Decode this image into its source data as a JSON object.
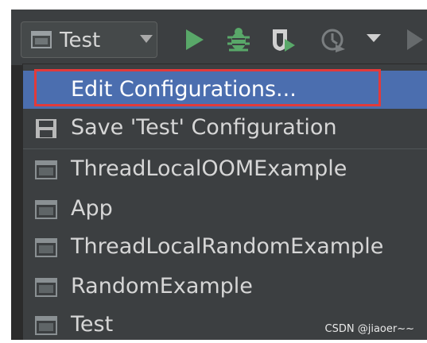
{
  "toolbar": {
    "run_config": {
      "label": "Test",
      "icon": "run-config-icon",
      "caret": "chevron-down-icon"
    },
    "buttons": [
      {
        "name": "run-button",
        "icon": "play-icon",
        "color": "#59a869"
      },
      {
        "name": "debug-button",
        "icon": "bug-icon",
        "color": "#59a869"
      },
      {
        "name": "coverage-button",
        "icon": "shield-play-icon",
        "color": "#59a869"
      },
      {
        "name": "profiler-button",
        "icon": "clock-icon",
        "color": "#8c8c8c"
      },
      {
        "name": "more-button",
        "icon": "chevron-down-icon",
        "color": "#8c8c8c"
      }
    ]
  },
  "menu": {
    "items": [
      {
        "label": "Edit Configurations...",
        "icon": "",
        "selected": true
      },
      {
        "label": "Save 'Test' Configuration",
        "icon": "save-icon",
        "selected": false
      },
      {
        "label": "ThreadLocalOOMExample",
        "icon": "run-config-icon",
        "selected": false
      },
      {
        "label": "App",
        "icon": "run-config-icon",
        "selected": false
      },
      {
        "label": "ThreadLocalRandomExample",
        "icon": "run-config-icon",
        "selected": false
      },
      {
        "label": "RandomExample",
        "icon": "run-config-icon",
        "selected": false
      },
      {
        "label": "Test",
        "icon": "run-config-icon",
        "selected": false
      }
    ]
  },
  "watermark": "CSDN @jiaoer~~",
  "colors": {
    "background": "#3c3f41",
    "selection": "#4b6eaf",
    "highlight_box": "#e23a3a",
    "text": "#d6d6d6",
    "run_green": "#59a869"
  }
}
